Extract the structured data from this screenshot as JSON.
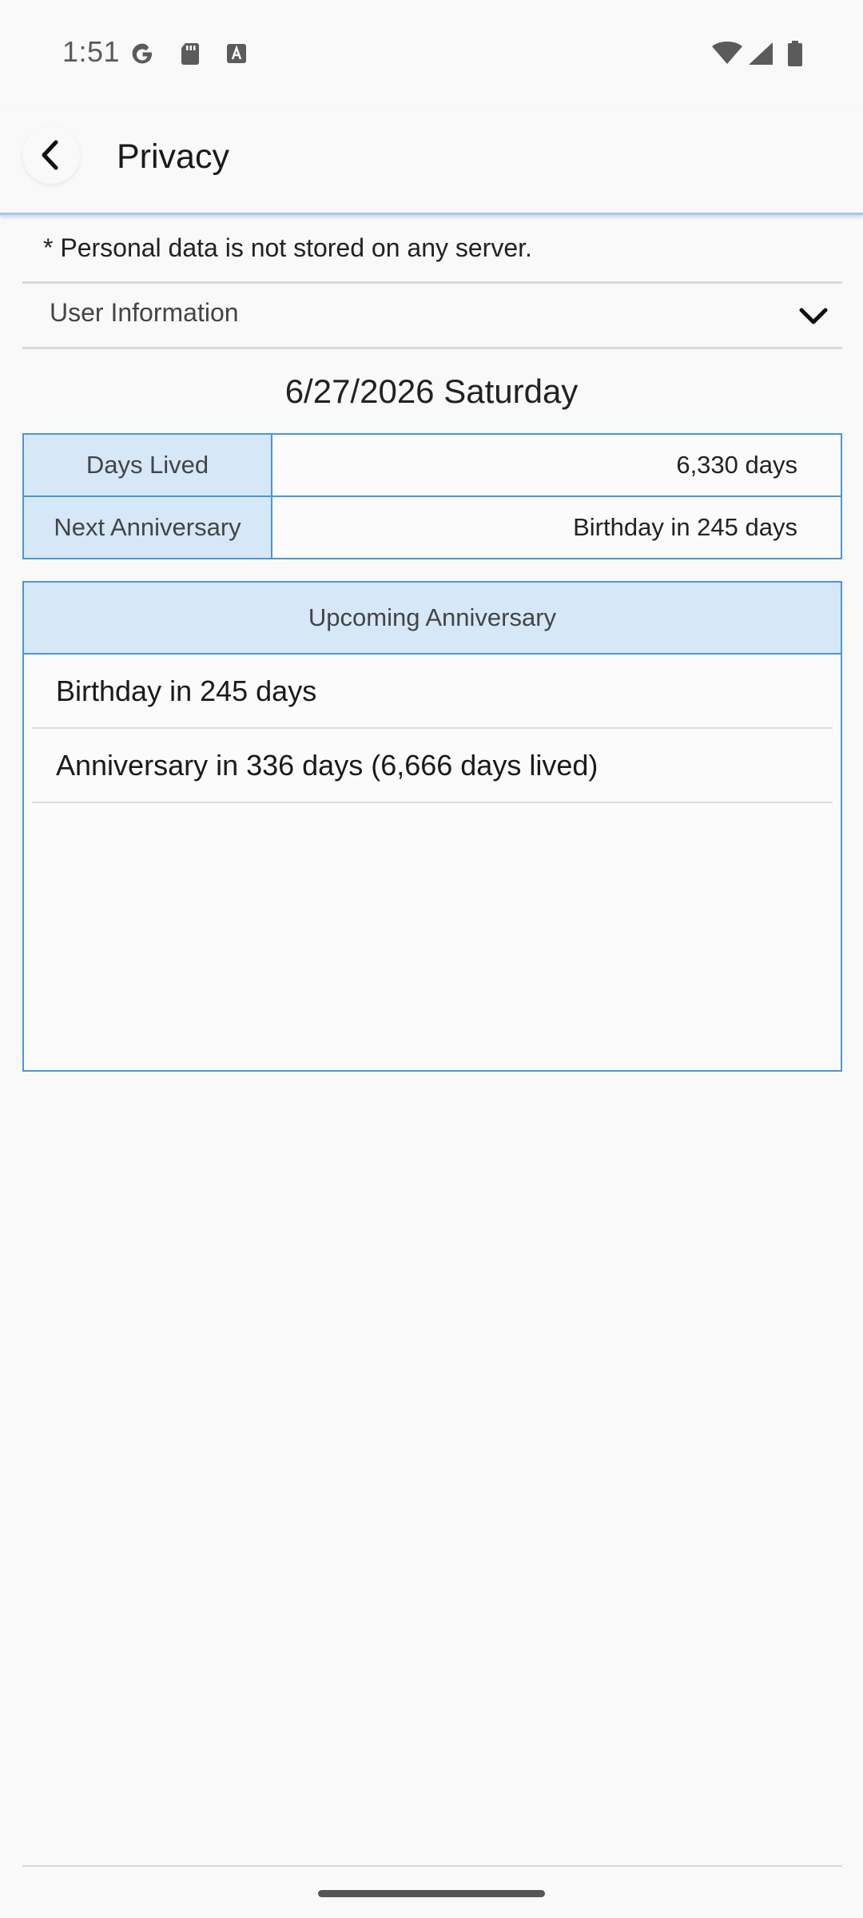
{
  "status_bar": {
    "time": "1:51",
    "icons": [
      "google-icon",
      "sd-card-icon",
      "keyboard-icon",
      "wifi-icon",
      "cell-signal-icon",
      "battery-icon"
    ]
  },
  "app_bar": {
    "title": "Privacy",
    "back_icon": "chevron-left-icon"
  },
  "privacy_note": "* Personal data is not stored on any server.",
  "user_info": {
    "label": "User Information",
    "icon": "chevron-down-icon",
    "expanded": false
  },
  "date_heading": "6/27/2026 Saturday",
  "info_table": [
    {
      "key": "Days Lived",
      "value": "6,330 days"
    },
    {
      "key": "Next Anniversary",
      "value": "Birthday in 245 days"
    }
  ],
  "upcoming": {
    "header": "Upcoming Anniversary",
    "items": [
      "Birthday in 245 days",
      "Anniversary in 336 days (6,666 days lived)"
    ]
  },
  "colors": {
    "accent_border": "#4a96d8",
    "accent_fill": "#d6e7f7",
    "background": "#f9f9f9"
  }
}
